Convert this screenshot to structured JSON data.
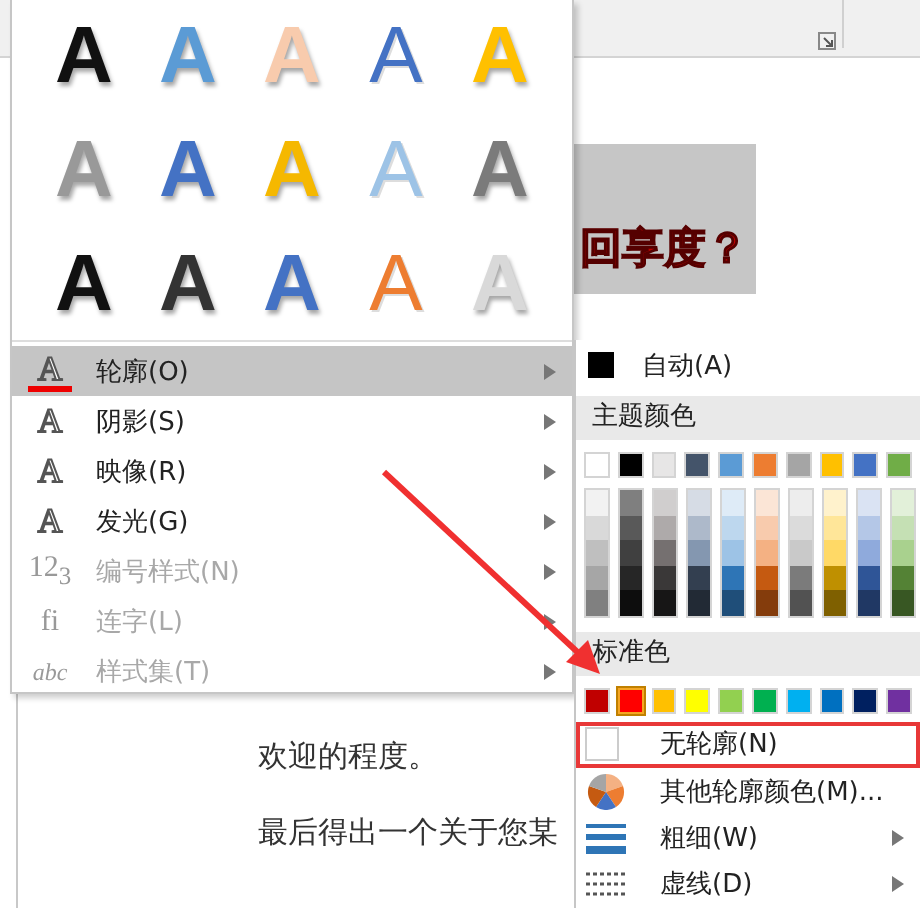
{
  "document": {
    "heading": "回享度？",
    "paragraphs": [
      "欢迎的程度。",
      "最后得出一个关于您某"
    ]
  },
  "gallery": [
    {
      "letter": "A",
      "kind": "fill",
      "color": "#111111"
    },
    {
      "letter": "A",
      "kind": "fill",
      "color": "#5b9bd5"
    },
    {
      "letter": "A",
      "kind": "fill",
      "color": "#f8cbad"
    },
    {
      "letter": "A",
      "kind": "outline",
      "color": "#4472c4"
    },
    {
      "letter": "A",
      "kind": "fill",
      "color": "#ffc000"
    },
    {
      "letter": "A",
      "kind": "fill",
      "color": "#999999"
    },
    {
      "letter": "A",
      "kind": "fill",
      "color": "#4472c4"
    },
    {
      "letter": "A",
      "kind": "fill",
      "color": "#f5b800"
    },
    {
      "letter": "A",
      "kind": "outline",
      "color": "#9dc3e6"
    },
    {
      "letter": "A",
      "kind": "fill",
      "color": "#7b7b7b"
    },
    {
      "letter": "A",
      "kind": "fill",
      "color": "#111111"
    },
    {
      "letter": "A",
      "kind": "fill",
      "color": "#333333"
    },
    {
      "letter": "A",
      "kind": "fill",
      "color": "#4472c4"
    },
    {
      "letter": "A",
      "kind": "outline",
      "color": "#ed7d31"
    },
    {
      "letter": "A",
      "kind": "fill",
      "color": "#d9d9d9"
    }
  ],
  "menu": [
    {
      "icon_text": "A",
      "kind": "outline",
      "label": "轮廓(O)",
      "selected": true,
      "disabled": false
    },
    {
      "icon_text": "A",
      "kind": "shadow",
      "label": "阴影(S)",
      "selected": false,
      "disabled": false
    },
    {
      "icon_text": "A",
      "kind": "reflection",
      "label": "映像(R)",
      "selected": false,
      "disabled": false
    },
    {
      "icon_text": "A",
      "kind": "glow",
      "label": "发光(G)",
      "selected": false,
      "disabled": false
    },
    {
      "icon_text": "12$_{3}$",
      "kind": "glyph",
      "label": "编号样式(N)",
      "selected": false,
      "disabled": true
    },
    {
      "icon_text": "fi",
      "kind": "glyph",
      "label": "连字(L)",
      "selected": false,
      "disabled": true
    },
    {
      "icon_text": "abc",
      "kind": "script",
      "label": "样式集(T)",
      "selected": false,
      "disabled": true
    }
  ],
  "submenu": {
    "auto": {
      "label": "自动(A)",
      "color": "#000000"
    },
    "theme_header": "主题颜色",
    "theme_colors": [
      {
        "color": "#ffffff",
        "selected": false
      },
      {
        "color": "#000000",
        "selected": false
      },
      {
        "color": "#e7e6e6",
        "selected": false
      },
      {
        "color": "#44546a",
        "selected": false
      },
      {
        "color": "#5b9bd5",
        "selected": false
      },
      {
        "color": "#ed7d31",
        "selected": false
      },
      {
        "color": "#a5a5a5",
        "selected": false
      },
      {
        "color": "#ffc000",
        "selected": false
      },
      {
        "color": "#4472c4",
        "selected": false
      },
      {
        "color": "#70ad47",
        "selected": false
      }
    ],
    "shades": [
      [
        {
          "color": "#f2f2f2"
        },
        {
          "color": "#d9d9d9"
        },
        {
          "color": "#bfbfbf"
        },
        {
          "color": "#a6a6a6"
        },
        {
          "color": "#808080"
        }
      ],
      [
        {
          "color": "#7f7f7f"
        },
        {
          "color": "#595959"
        },
        {
          "color": "#404040"
        },
        {
          "color": "#262626"
        },
        {
          "color": "#0d0d0d"
        }
      ],
      [
        {
          "color": "#d0cece"
        },
        {
          "color": "#aeaaaa"
        },
        {
          "color": "#757070"
        },
        {
          "color": "#3a3838"
        },
        {
          "color": "#171616"
        }
      ],
      [
        {
          "color": "#d6dce5"
        },
        {
          "color": "#adb9ca"
        },
        {
          "color": "#8497b0"
        },
        {
          "color": "#333f50"
        },
        {
          "color": "#222a35"
        }
      ],
      [
        {
          "color": "#deebf7"
        },
        {
          "color": "#bdd7ee"
        },
        {
          "color": "#9dc3e6"
        },
        {
          "color": "#2e75b6"
        },
        {
          "color": "#1f4e79"
        }
      ],
      [
        {
          "color": "#fbe5d6"
        },
        {
          "color": "#f8cbad"
        },
        {
          "color": "#f4b183"
        },
        {
          "color": "#c55a11"
        },
        {
          "color": "#843c0c"
        }
      ],
      [
        {
          "color": "#ededed"
        },
        {
          "color": "#dbdbdb"
        },
        {
          "color": "#c9c9c9"
        },
        {
          "color": "#7b7b7b"
        },
        {
          "color": "#525252"
        }
      ],
      [
        {
          "color": "#fff2cc"
        },
        {
          "color": "#ffe699"
        },
        {
          "color": "#ffd966"
        },
        {
          "color": "#bf9000"
        },
        {
          "color": "#7f6000"
        }
      ],
      [
        {
          "color": "#dae3f3"
        },
        {
          "color": "#b4c7e7"
        },
        {
          "color": "#8faadc"
        },
        {
          "color": "#2f5597"
        },
        {
          "color": "#203864"
        }
      ],
      [
        {
          "color": "#e2f0d9"
        },
        {
          "color": "#c5e0b4"
        },
        {
          "color": "#a9d18e"
        },
        {
          "color": "#548235"
        },
        {
          "color": "#385723"
        }
      ]
    ],
    "standard_header": "标准色",
    "standard_colors": [
      {
        "color": "#c00000",
        "selected": false
      },
      {
        "color": "#ff0000",
        "selected": true
      },
      {
        "color": "#ffc000",
        "selected": false
      },
      {
        "color": "#ffff00",
        "selected": false
      },
      {
        "color": "#92d050",
        "selected": false
      },
      {
        "color": "#00b050",
        "selected": false
      },
      {
        "color": "#00b0f0",
        "selected": false
      },
      {
        "color": "#0070c0",
        "selected": false
      },
      {
        "color": "#002060",
        "selected": false
      },
      {
        "color": "#7030a0",
        "selected": false
      }
    ],
    "items": [
      {
        "kind": "none",
        "label": "无轮廓(N)",
        "marked": true,
        "submenu": false
      },
      {
        "kind": "more",
        "label": "其他轮廓颜色(M)...",
        "marked": false,
        "submenu": false
      },
      {
        "kind": "weight",
        "label": "粗细(W)",
        "marked": false,
        "submenu": true
      },
      {
        "kind": "dash",
        "label": "虚线(D)",
        "marked": false,
        "submenu": true
      }
    ]
  }
}
